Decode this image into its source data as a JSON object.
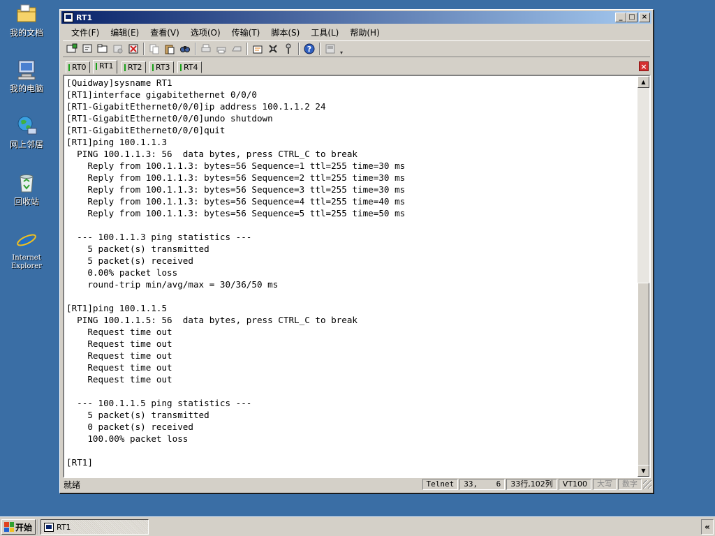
{
  "desktop": {
    "icons": [
      {
        "label": "我的文档"
      },
      {
        "label": "我的电脑"
      },
      {
        "label": "网上邻居"
      },
      {
        "label": "回收站"
      },
      {
        "label": "Internet\nExplorer"
      }
    ]
  },
  "window": {
    "title": "RT1",
    "controls": {
      "minimize": "_",
      "maximize": "□",
      "close": "×"
    }
  },
  "menu": [
    "文件(F)",
    "编辑(E)",
    "查看(V)",
    "选项(O)",
    "传输(T)",
    "脚本(S)",
    "工具(L)",
    "帮助(H)"
  ],
  "tabs": [
    {
      "label": "RT0",
      "active": false
    },
    {
      "label": "RT1",
      "active": true
    },
    {
      "label": "RT2",
      "active": false
    },
    {
      "label": "RT3",
      "active": false
    },
    {
      "label": "RT4",
      "active": false
    }
  ],
  "terminal": {
    "lines": [
      "[Quidway]sysname RT1",
      "[RT1]interface gigabitethernet 0/0/0",
      "[RT1-GigabitEthernet0/0/0]ip address 100.1.1.2 24",
      "[RT1-GigabitEthernet0/0/0]undo shutdown",
      "[RT1-GigabitEthernet0/0/0]quit",
      "[RT1]ping 100.1.1.3",
      "  PING 100.1.1.3: 56  data bytes, press CTRL_C to break",
      "    Reply from 100.1.1.3: bytes=56 Sequence=1 ttl=255 time=30 ms",
      "    Reply from 100.1.1.3: bytes=56 Sequence=2 ttl=255 time=30 ms",
      "    Reply from 100.1.1.3: bytes=56 Sequence=3 ttl=255 time=30 ms",
      "    Reply from 100.1.1.3: bytes=56 Sequence=4 ttl=255 time=40 ms",
      "    Reply from 100.1.1.3: bytes=56 Sequence=5 ttl=255 time=50 ms",
      "",
      "  --- 100.1.1.3 ping statistics ---",
      "    5 packet(s) transmitted",
      "    5 packet(s) received",
      "    0.00% packet loss",
      "    round-trip min/avg/max = 30/36/50 ms",
      "",
      "[RT1]ping 100.1.1.5",
      "  PING 100.1.1.5: 56  data bytes, press CTRL_C to break",
      "    Request time out",
      "    Request time out",
      "    Request time out",
      "    Request time out",
      "    Request time out",
      "",
      "  --- 100.1.1.5 ping statistics ---",
      "    5 packet(s) transmitted",
      "    0 packet(s) received",
      "    100.00% packet loss",
      "",
      "[RT1]"
    ]
  },
  "status": {
    "ready": "就绪",
    "protocol": "Telnet",
    "cursor": "33,    6",
    "size": "33行,102列",
    "emulation": "VT100",
    "caps": "大写",
    "num": "数字"
  },
  "taskbar": {
    "start_label": "开始",
    "task_label": "RT1",
    "tray_label": "«"
  }
}
